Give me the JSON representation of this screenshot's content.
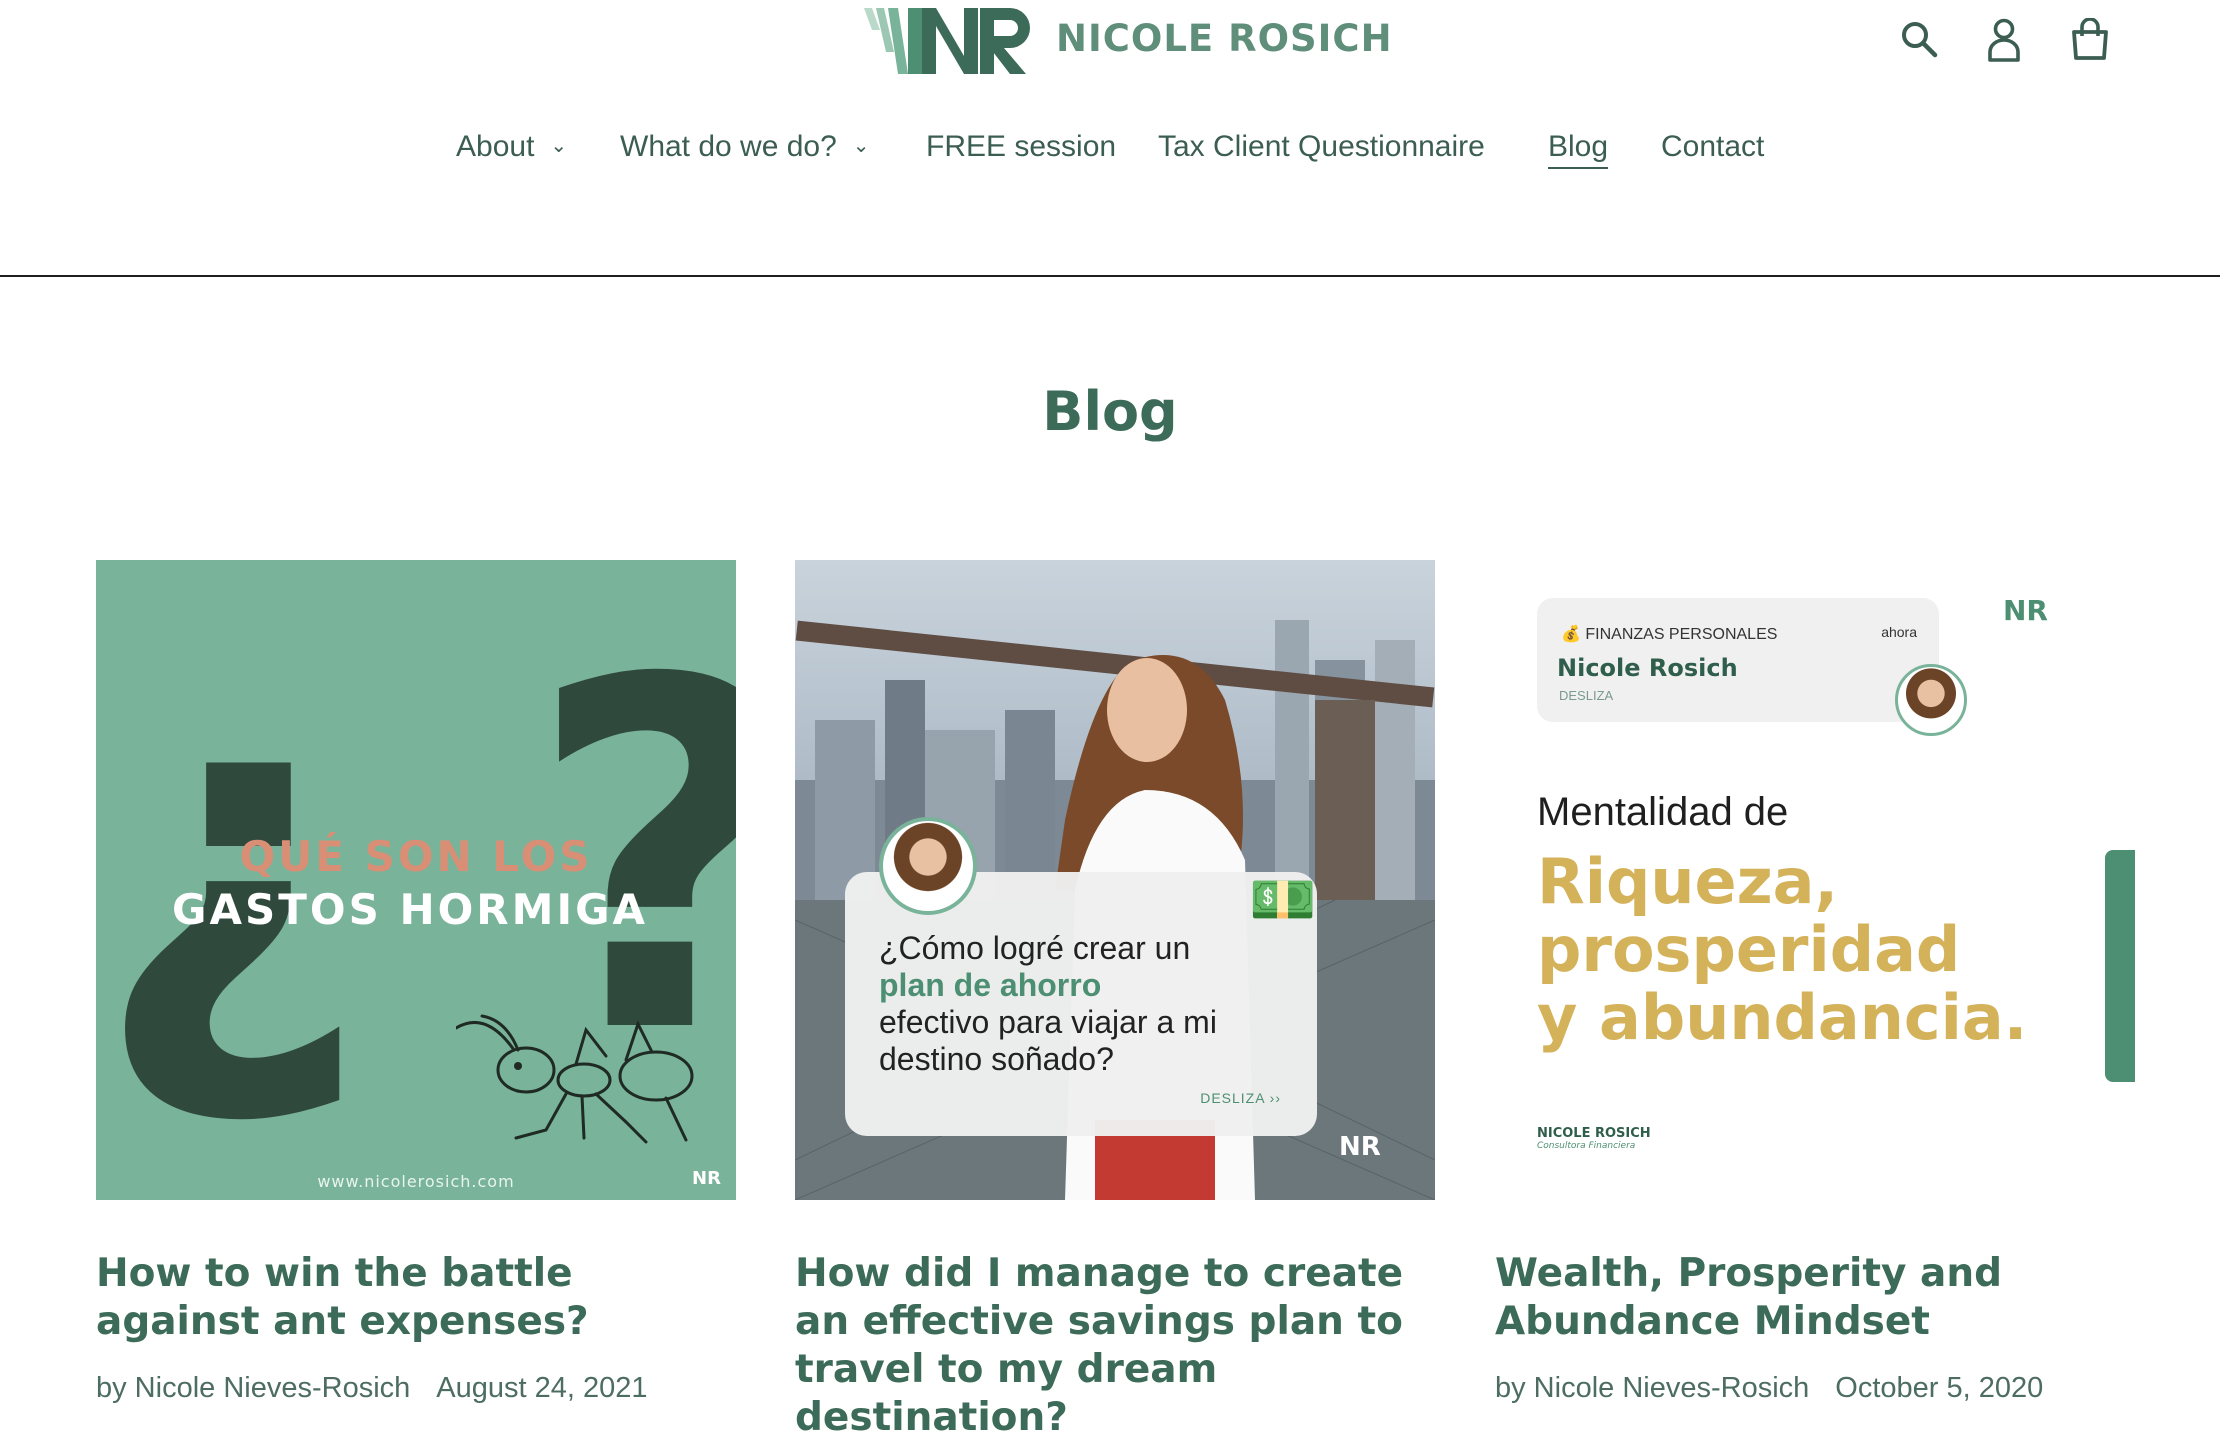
{
  "brand": {
    "name": "NICOLE ROSICH",
    "logo_letters": "NR"
  },
  "header": {
    "icons": [
      "search-icon",
      "account-icon",
      "cart-icon"
    ]
  },
  "nav": {
    "items": [
      {
        "label": "About",
        "dropdown": true
      },
      {
        "label": "What do we do?",
        "dropdown": true
      },
      {
        "label": "FREE session",
        "dropdown": false
      },
      {
        "label": "Tax Client Questionnaire",
        "dropdown": false
      },
      {
        "label": "Blog",
        "dropdown": false,
        "active": true
      },
      {
        "label": "Contact",
        "dropdown": false
      }
    ]
  },
  "page": {
    "title": "Blog"
  },
  "posts": [
    {
      "title": "How to win the battle against ant expenses?",
      "author": "by Nicole Nieves-Rosich",
      "date": "August 24, 2021",
      "image": {
        "line1": "QUÉ SON LOS",
        "line2": "GASTOS HORMIGA",
        "q_open": "¿",
        "q_close": "?",
        "site": "www.nicolerosich.com",
        "logo": "NR"
      }
    },
    {
      "title": "How did I manage to create an effective savings plan to travel to my dream destination?",
      "author": "",
      "date": "",
      "image": {
        "pre": "¿Cómo logré crear un",
        "highlight": "plan de ahorro",
        "post": "efectivo para viajar a mi destino soñado?",
        "cta": "DESLIZA ››",
        "logo": "NR"
      }
    },
    {
      "title": "Wealth, Prosperity and Abundance Mindset",
      "author": "by Nicole Nieves-Rosich",
      "date": "October 5, 2020",
      "image": {
        "app": "💰 FINANZAS PERSONALES",
        "time": "ahora",
        "name": "Nicole Rosich",
        "sub": "DESLIZA",
        "heading": "Mentalidad de",
        "big1": "Riqueza,",
        "big2": "prosperidad",
        "big3": "y abundancia.",
        "brand": "NICOLE ROSICH",
        "tagline": "Consultora Financiera",
        "logo": "NR"
      }
    }
  ],
  "colors": {
    "brand_green": "#3d6b5a",
    "mint": "#79b39a",
    "dark_green": "#2f4a3d",
    "gold": "#d4b25a",
    "coral": "#d98f75"
  }
}
